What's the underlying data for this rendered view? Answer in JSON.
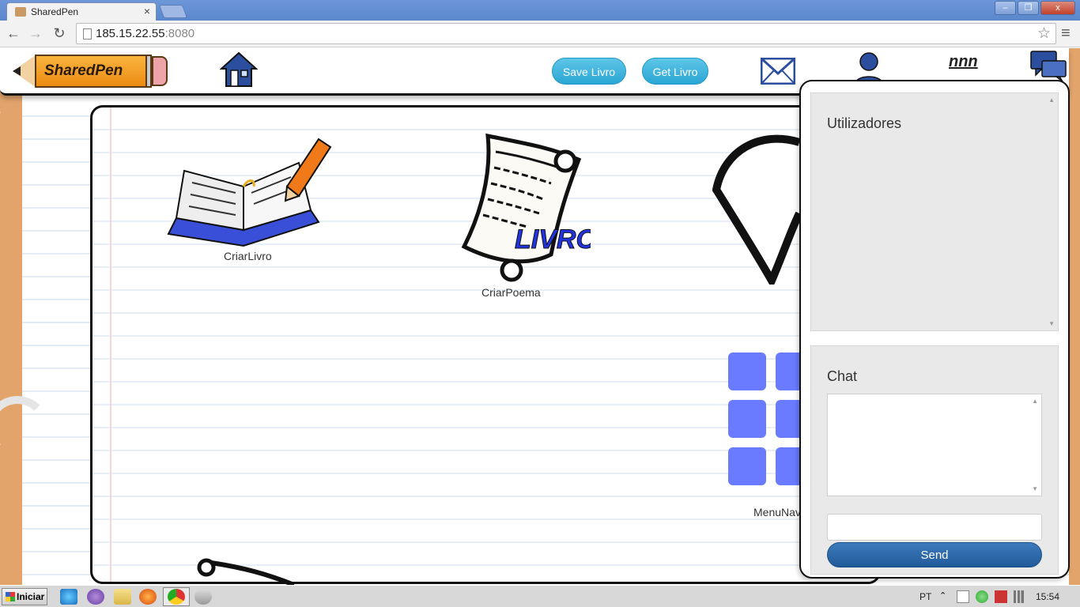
{
  "browser": {
    "tab_title": "SharedPen",
    "tab_close": "×",
    "url_host": "185.15.22.55",
    "url_port": ":8080",
    "back": "←",
    "forward": "→",
    "reload": "↻",
    "bookmark": "☆",
    "menu": "≡",
    "window_buttons": {
      "minimize": "–",
      "restore": "❐",
      "close": "x"
    }
  },
  "header": {
    "logo_text": "SharedPen",
    "save_label": "Save Livro",
    "get_label": "Get Livro",
    "username": "nnn",
    "icons": [
      "home-icon",
      "mail-icon",
      "user-icon",
      "chat-icon"
    ]
  },
  "board": {
    "tiles": [
      {
        "label": "CriarLivro",
        "icon": "open-book-pencil-icon"
      },
      {
        "label": "CriarPoema",
        "icon": "scroll-livro-icon",
        "icon_text": "LIVRO"
      },
      {
        "label": "MenuNav",
        "icon": "grid-icon"
      }
    ]
  },
  "panel": {
    "users_title": "Utilizadores",
    "chat_title": "Chat",
    "message_placeholder": "",
    "send_label": "Send"
  },
  "taskbar": {
    "start_label": "Iniciar",
    "language": "PT",
    "time": "15:54"
  },
  "colors": {
    "titlebar": "#5a86cc",
    "wood": "#e2a46b",
    "pill_button": "#2aa6d4",
    "send_button": "#215a99",
    "grid_tile": "#6a7bff",
    "icon_blue": "#2c4e9e"
  }
}
